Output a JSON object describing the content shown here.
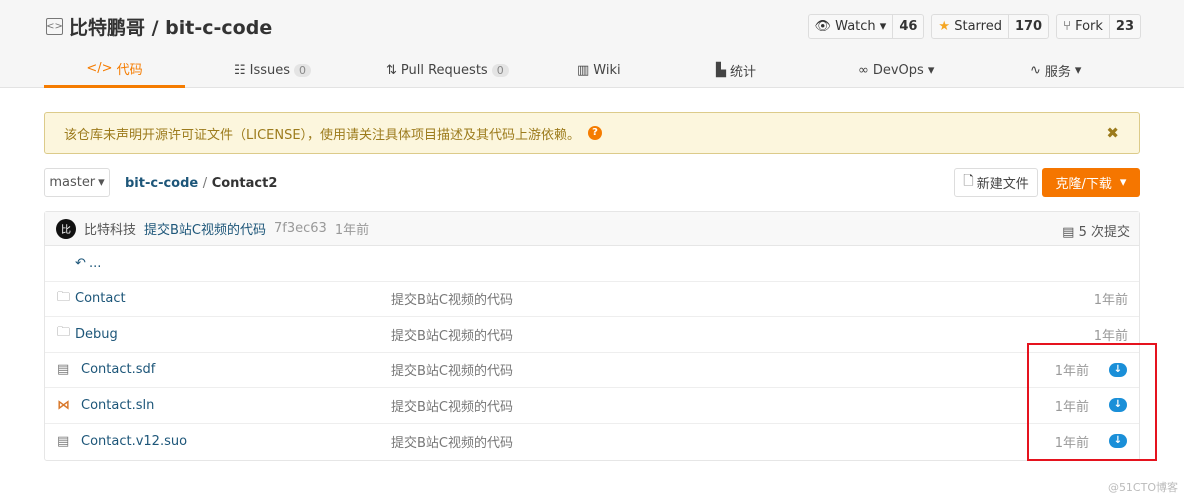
{
  "repo": {
    "owner": "比特鹏哥",
    "name": "bit-c-code",
    "title": "比特鹏哥 / bit-c-code"
  },
  "actions": {
    "watch": {
      "label": "Watch",
      "count": "46"
    },
    "star": {
      "label": "Starred",
      "count": "170"
    },
    "fork": {
      "label": "Fork",
      "count": "23"
    }
  },
  "tabs": [
    {
      "label": "代码",
      "icon": "code-icon"
    },
    {
      "label": "Issues",
      "count": "0"
    },
    {
      "label": "Pull Requests",
      "count": "0"
    },
    {
      "label": "Wiki"
    },
    {
      "label": "统计"
    },
    {
      "label": "DevOps"
    },
    {
      "label": "服务"
    }
  ],
  "notice": {
    "text": "该仓库未声明开源许可证文件（LICENSE），使用请关注具体项目描述及其代码上游依赖。",
    "close": "✖"
  },
  "branch": "master",
  "breadcrumb": {
    "root": "bit-c-code",
    "sep": "/",
    "current": "Contact2"
  },
  "buttons": {
    "new_file": "新建文件",
    "clone": "克隆/下载"
  },
  "commit": {
    "avatar": "比",
    "author": "比特科技",
    "message": "提交B站C视频的代码",
    "hash": "7f3ec63",
    "time": "1年前",
    "count": "5 次提交"
  },
  "parent": "...",
  "files": [
    {
      "name": "Contact",
      "type": "folder",
      "message": "提交B站C视频的代码",
      "time": "1年前"
    },
    {
      "name": "Debug",
      "type": "folder",
      "message": "提交B站C视频的代码",
      "time": "1年前"
    },
    {
      "name": "Contact.sdf",
      "type": "file",
      "message": "提交B站C视频的代码",
      "time": "1年前"
    },
    {
      "name": "Contact.sln",
      "type": "vs-solution",
      "message": "提交B站C视频的代码",
      "time": "1年前"
    },
    {
      "name": "Contact.v12.suo",
      "type": "file",
      "message": "提交B站C视频的代码",
      "time": "1年前"
    }
  ],
  "watermark": "@51CTO博客",
  "colors": {
    "accent": "#f57600",
    "link": "#1d5679",
    "highlight": "#e5131e",
    "download": "#1a8fd8"
  }
}
